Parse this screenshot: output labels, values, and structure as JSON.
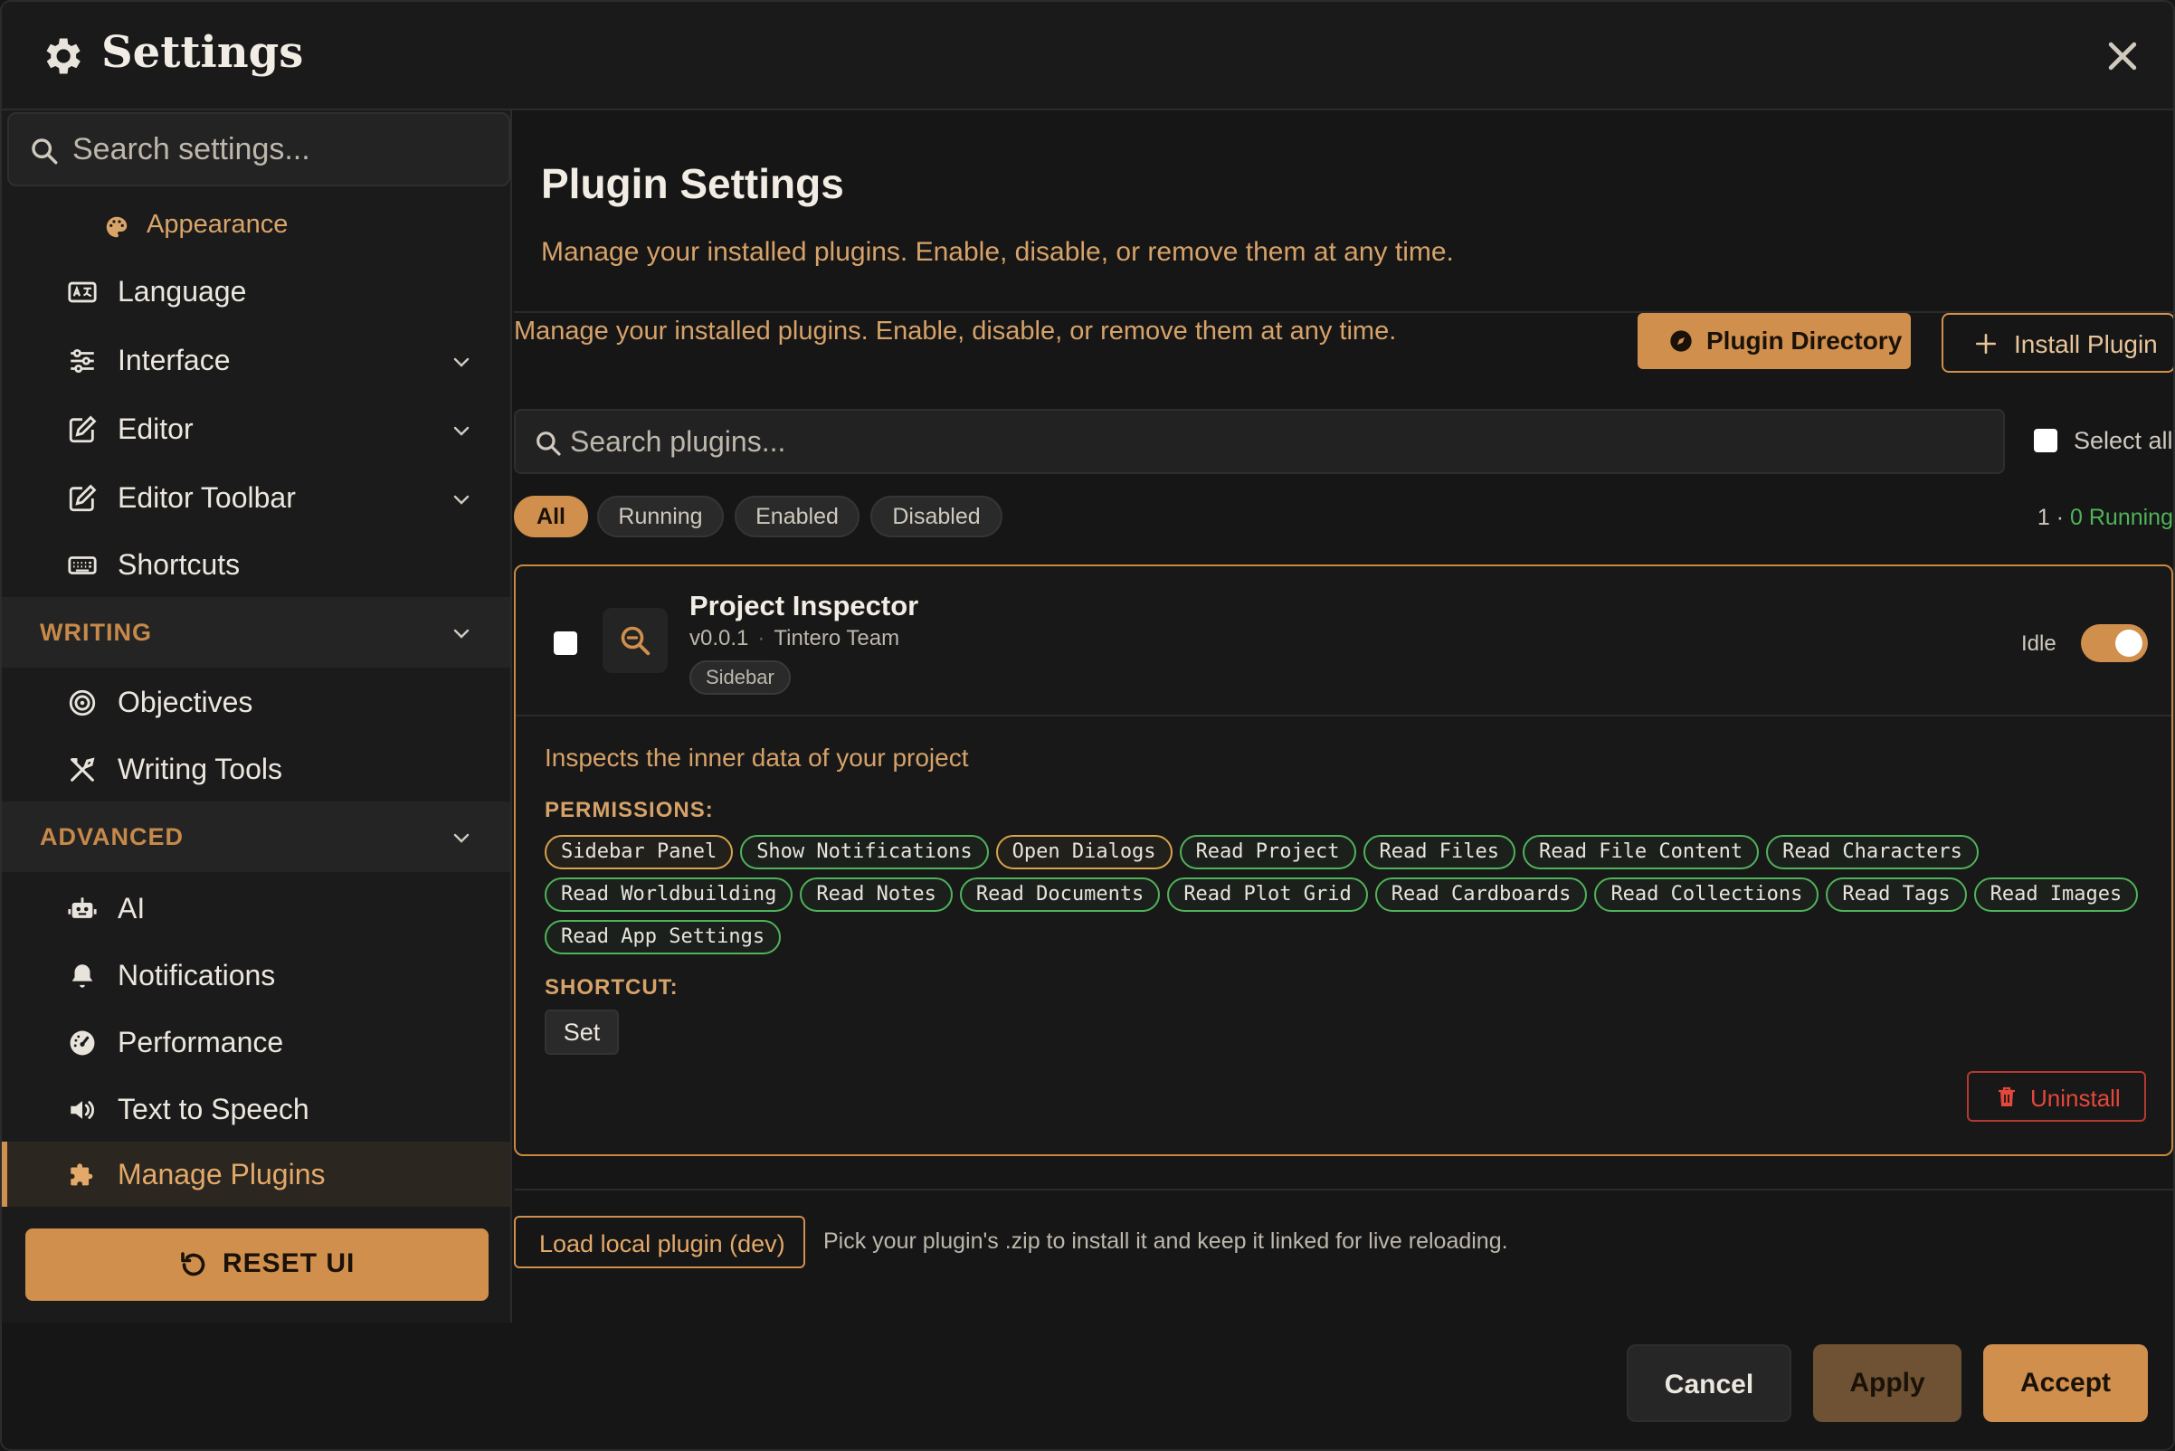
{
  "window": {
    "title": "Settings"
  },
  "sidebar": {
    "search_placeholder": "Search settings...",
    "items": [
      {
        "label": "Appearance",
        "icon": "palette-icon"
      },
      {
        "label": "Language",
        "icon": "language-icon"
      },
      {
        "label": "Interface",
        "icon": "sliders-icon"
      },
      {
        "label": "Editor",
        "icon": "edit-icon"
      },
      {
        "label": "Editor Toolbar",
        "icon": "edit-icon"
      },
      {
        "label": "Shortcuts",
        "icon": "keyboard-icon"
      }
    ],
    "sections": [
      {
        "label": "WRITING",
        "items": [
          {
            "label": "Objectives",
            "icon": "target-icon"
          },
          {
            "label": "Writing Tools",
            "icon": "tools-icon"
          }
        ]
      },
      {
        "label": "ADVANCED",
        "items": [
          {
            "label": "AI",
            "icon": "robot-icon"
          },
          {
            "label": "Notifications",
            "icon": "bell-icon"
          },
          {
            "label": "Performance",
            "icon": "gauge-icon"
          },
          {
            "label": "Text to Speech",
            "icon": "speaker-icon"
          },
          {
            "label": "Manage Plugins",
            "icon": "puzzle-icon"
          }
        ]
      }
    ],
    "reset_label": "RESET UI"
  },
  "main": {
    "title": "Plugin Settings",
    "description": "Manage your installed plugins. Enable, disable, or remove them at any time.",
    "description_repeat": "Manage your installed plugins. Enable, disable, or remove them at any time.",
    "directory_label": "Plugin Directory",
    "install_label": "Install Plugin",
    "search_placeholder": "Search plugins...",
    "select_all_label": "Select all",
    "filters": [
      "All",
      "Running",
      "Enabled",
      "Disabled"
    ],
    "count_total": "1",
    "count_sep": "·",
    "count_running": "0 Running",
    "plugin": {
      "name": "Project Inspector",
      "version": "v0.0.1",
      "author": "Tintero Team",
      "tag": "Sidebar",
      "status": "Idle",
      "enabled": true,
      "description": "Inspects the inner data of your project",
      "permissions_title": "PERMISSIONS:",
      "permissions": [
        {
          "label": "Sidebar Panel",
          "level": "warn"
        },
        {
          "label": "Show Notifications",
          "level": "ok"
        },
        {
          "label": "Open Dialogs",
          "level": "warn"
        },
        {
          "label": "Read Project",
          "level": "ok"
        },
        {
          "label": "Read Files",
          "level": "ok"
        },
        {
          "label": "Read File Content",
          "level": "ok"
        },
        {
          "label": "Read Characters",
          "level": "ok"
        },
        {
          "label": "Read Worldbuilding",
          "level": "ok"
        },
        {
          "label": "Read Notes",
          "level": "ok"
        },
        {
          "label": "Read Documents",
          "level": "ok"
        },
        {
          "label": "Read Plot Grid",
          "level": "ok"
        },
        {
          "label": "Read Cardboards",
          "level": "ok"
        },
        {
          "label": "Read Collections",
          "level": "ok"
        },
        {
          "label": "Read Tags",
          "level": "ok"
        },
        {
          "label": "Read Images",
          "level": "ok"
        },
        {
          "label": "Read App Settings",
          "level": "ok"
        }
      ],
      "shortcut_title": "SHORTCUT:",
      "shortcut_button": "Set",
      "uninstall_label": "Uninstall"
    },
    "local_plugin_label": "Load local plugin (dev)",
    "local_plugin_hint": "Pick your plugin's .zip to install it and keep it linked for live reloading."
  },
  "footer": {
    "cancel": "Cancel",
    "apply": "Apply",
    "accept": "Accept"
  },
  "colors": {
    "accent": "#d08f4d",
    "running": "#4fb35a",
    "danger": "#e5473b",
    "background": "#161616"
  }
}
